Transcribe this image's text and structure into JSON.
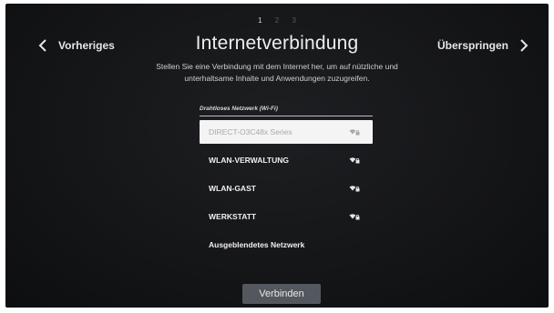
{
  "steps": [
    "1",
    "2",
    "3"
  ],
  "active_step": 1,
  "nav": {
    "prev_label": "Vorheriges",
    "next_label": "Überspringen"
  },
  "title": "Internetverbindung",
  "subtitle_line1": "Stellen Sie eine Verbindung mit dem Internet her, um auf nützliche und",
  "subtitle_line2": "unterhaltsame Inhalte und Anwendungen zuzugreifen.",
  "list_header": "Drahtloses Netzwerk (Wi-Fi)",
  "networks": [
    {
      "name": "DIRECT-O3C48x Series",
      "secured": true,
      "selected": true
    },
    {
      "name": "WLAN-VERWALTUNG",
      "secured": true,
      "selected": false
    },
    {
      "name": "WLAN-GAST",
      "secured": true,
      "selected": false
    },
    {
      "name": "WERKSTATT",
      "secured": true,
      "selected": false
    },
    {
      "name": "Ausgeblendetes Netzwerk",
      "secured": false,
      "selected": false
    }
  ],
  "connect_label": "Verbinden",
  "icons": {
    "prev": "chevron-left-icon",
    "next": "chevron-right-icon",
    "secured_wifi": "wifi-lock-icon"
  },
  "colors": {
    "background": "#141517",
    "selected_item_bg": "#f4f4f4",
    "button_bg": "#53585f"
  }
}
